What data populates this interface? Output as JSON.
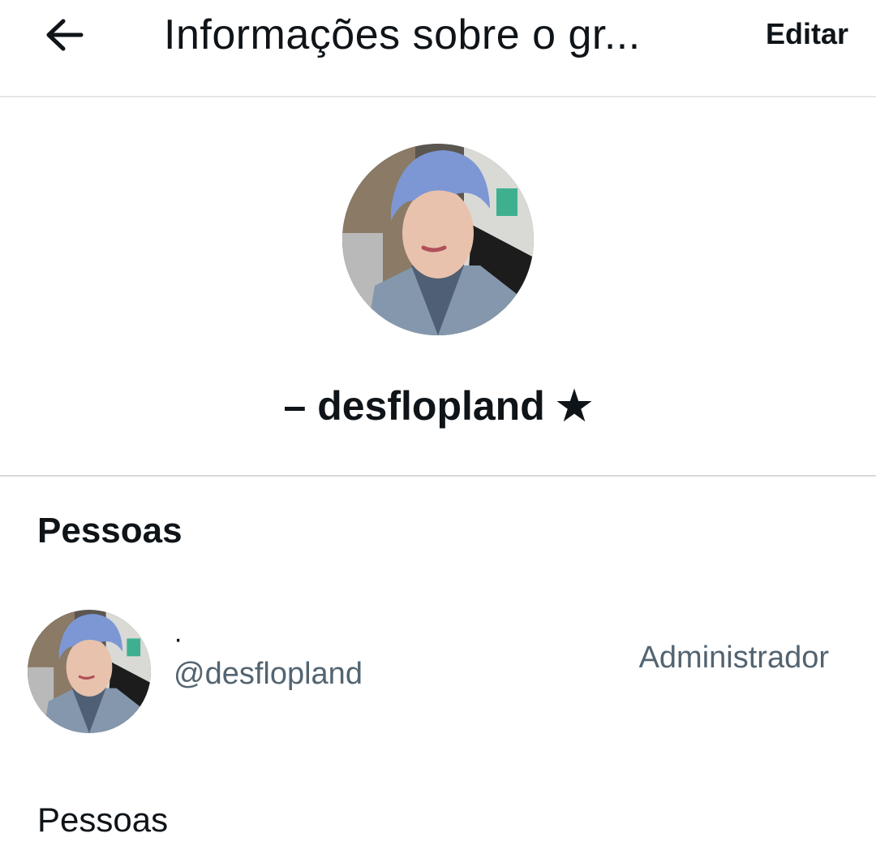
{
  "header": {
    "title": "Informações sobre o gr...",
    "edit_label": "Editar",
    "back_icon": "arrow-left-icon"
  },
  "group": {
    "name": "– desflopland ★",
    "avatar": "group-avatar-photo"
  },
  "people_section": {
    "title": "Pessoas",
    "members": [
      {
        "name": "·",
        "handle": "@desflopland",
        "role": "Administrador"
      }
    ]
  },
  "footer_section": {
    "title": "Pessoas"
  },
  "colors": {
    "text_primary": "#0f1419",
    "text_secondary": "#536471",
    "divider": "#d9d9d9",
    "hair_blue": "#7d97d4"
  }
}
